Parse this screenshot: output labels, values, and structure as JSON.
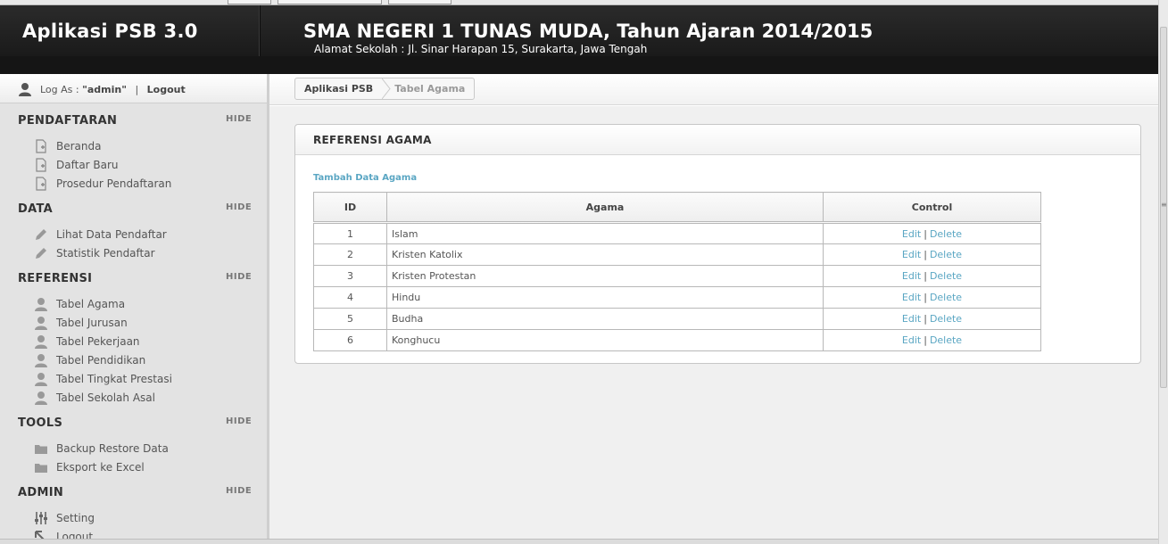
{
  "header": {
    "app_title": "Aplikasi PSB 3.0",
    "school_title": "SMA NEGERI 1 TUNAS MUDA, Tahun Ajaran 2014/2015",
    "school_address": "Alamat Sekolah : Jl. Sinar Harapan 15, Surakarta, Jawa Tengah"
  },
  "userbar": {
    "log_as_label": "Log As :",
    "username": "\"admin\"",
    "separator": "|",
    "logout": "Logout",
    "icon": "user-icon"
  },
  "sidebar": {
    "hide_label": "HIDE",
    "sections": [
      {
        "title": "PENDAFTARAN",
        "items": [
          {
            "label": "Beranda",
            "icon": "page-add-icon"
          },
          {
            "label": "Daftar Baru",
            "icon": "page-add-icon"
          },
          {
            "label": "Prosedur Pendaftaran",
            "icon": "page-add-icon"
          }
        ]
      },
      {
        "title": "DATA",
        "items": [
          {
            "label": "Lihat Data Pendaftar",
            "icon": "pencil-icon"
          },
          {
            "label": "Statistik Pendaftar",
            "icon": "pencil-icon"
          }
        ]
      },
      {
        "title": "REFERENSI",
        "items": [
          {
            "label": "Tabel Agama",
            "icon": "user-icon"
          },
          {
            "label": "Tabel Jurusan",
            "icon": "user-icon"
          },
          {
            "label": "Tabel Pekerjaan",
            "icon": "user-icon"
          },
          {
            "label": "Tabel Pendidikan",
            "icon": "user-icon"
          },
          {
            "label": "Tabel Tingkat Prestasi",
            "icon": "user-icon"
          },
          {
            "label": "Tabel Sekolah Asal",
            "icon": "user-icon"
          }
        ]
      },
      {
        "title": "TOOLS",
        "items": [
          {
            "label": "Backup Restore Data",
            "icon": "folder-icon"
          },
          {
            "label": "Eksport ke Excel",
            "icon": "folder-icon"
          }
        ]
      },
      {
        "title": "ADMIN",
        "items": [
          {
            "label": "Setting",
            "icon": "sliders-icon"
          },
          {
            "label": "Logout",
            "icon": "arrow-up-left-icon"
          }
        ]
      }
    ]
  },
  "breadcrumb": {
    "root": "Aplikasi PSB",
    "current": "Tabel Agama"
  },
  "panel": {
    "title": "REFERENSI AGAMA",
    "add_link": "Tambah Data Agama",
    "columns": [
      "ID",
      "Agama",
      "Control"
    ],
    "edit_label": "Edit",
    "delete_label": "Delete",
    "control_sep": "|",
    "rows": [
      {
        "id": "1",
        "agama": "Islam"
      },
      {
        "id": "2",
        "agama": "Kristen Katolix"
      },
      {
        "id": "3",
        "agama": "Kristen Protestan"
      },
      {
        "id": "4",
        "agama": "Hindu"
      },
      {
        "id": "5",
        "agama": "Budha"
      },
      {
        "id": "6",
        "agama": "Konghucu"
      }
    ]
  },
  "colors": {
    "header_bg": "#1f1f1f",
    "sidebar_bg": "#e3e3e3",
    "link": "#5aa6c3"
  }
}
